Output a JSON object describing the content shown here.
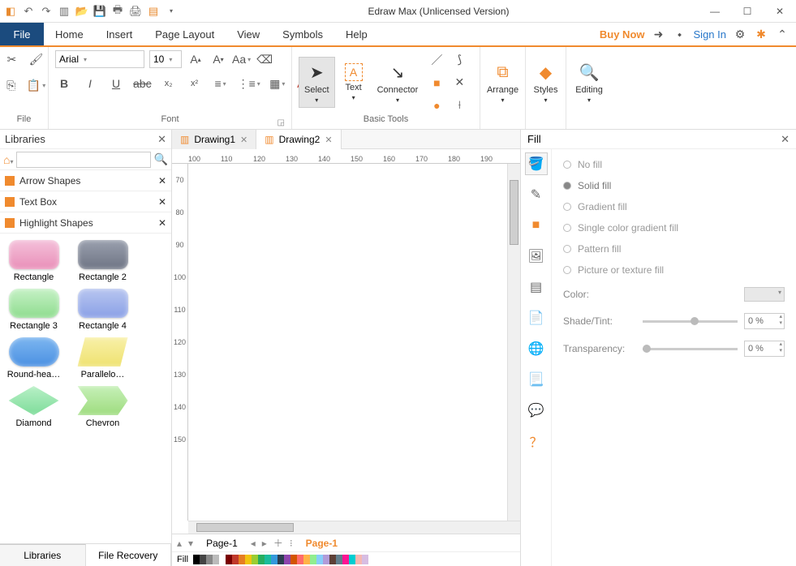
{
  "app": {
    "title": "Edraw Max (Unlicensed Version)"
  },
  "menu": {
    "file": "File",
    "tabs": [
      "Home",
      "Insert",
      "Page Layout",
      "View",
      "Symbols",
      "Help"
    ],
    "active_tab": "Home",
    "buy": "Buy Now",
    "signin": "Sign In"
  },
  "ribbon": {
    "group_file": "File",
    "group_font": "Font",
    "group_tools": "Basic Tools",
    "font_name": "Arial",
    "font_size": "10",
    "select": "Select",
    "text": "Text",
    "connector": "Connector",
    "arrange": "Arrange",
    "styles": "Styles",
    "editing": "Editing"
  },
  "libraries": {
    "title": "Libraries",
    "search_placeholder": "",
    "cats": [
      "Arrow Shapes",
      "Text Box",
      "Highlight Shapes"
    ],
    "shapes": [
      {
        "name": "Rectangle",
        "bg": "linear-gradient(#f4c1da,#e98fb8)",
        "radius": "10px"
      },
      {
        "name": "Rectangle 2",
        "bg": "linear-gradient(#9aa0ae,#6e7484)",
        "radius": "10px"
      },
      {
        "name": "Rectangle 3",
        "bg": "linear-gradient(#c6f1c6,#8edc8e)",
        "radius": "12px"
      },
      {
        "name": "Rectangle 4",
        "bg": "linear-gradient(#b8c6f0,#8aa0e6)",
        "radius": "10px"
      },
      {
        "name": "Round-hea…",
        "bg": "linear-gradient(#7db6f0,#4a90e2)",
        "radius": "18px"
      },
      {
        "name": "Parallelo…",
        "bg": "linear-gradient(#f8f0a8,#efe270)",
        "clip": "polygon(15% 0,100% 0,85% 100%,0 100%)"
      },
      {
        "name": "Diamond",
        "bg": "linear-gradient(#b8f0c6,#7edc9a)",
        "clip": "polygon(50% 0,100% 50%,50% 100%,0 50%)"
      },
      {
        "name": "Chevron",
        "bg": "linear-gradient(#c6f0b8,#9edc7e)",
        "clip": "polygon(0 0,80% 0,100% 50%,80% 100%,0 100%,20% 50%)"
      }
    ],
    "bottom_tabs": [
      "Libraries",
      "File Recovery"
    ]
  },
  "docs": {
    "tabs": [
      "Drawing1",
      "Drawing2"
    ],
    "active": 1
  },
  "ruler_h": [
    "100",
    "110",
    "120",
    "130",
    "140",
    "150",
    "160",
    "170",
    "180",
    "190"
  ],
  "ruler_v": [
    "70",
    "80",
    "90",
    "100",
    "110",
    "120",
    "130",
    "140",
    "150"
  ],
  "page_tabs": {
    "current": "Page-1",
    "selected": "Page-1"
  },
  "fill_row_label": "Fill",
  "fill": {
    "title": "Fill",
    "options": [
      "No fill",
      "Solid fill",
      "Gradient fill",
      "Single color gradient fill",
      "Pattern fill",
      "Picture or texture fill"
    ],
    "selected": 1,
    "color_label": "Color:",
    "shade_label": "Shade/Tint:",
    "shade_value": "0 %",
    "trans_label": "Transparency:",
    "trans_value": "0 %"
  },
  "swatches": [
    "#000",
    "#444",
    "#888",
    "#bbb",
    "#fff",
    "#7a0000",
    "#c0392b",
    "#e67e22",
    "#f1c40f",
    "#9acd32",
    "#27ae60",
    "#1abc9c",
    "#3498db",
    "#2c3e50",
    "#8e44ad",
    "#d35400",
    "#ff6b6b",
    "#ffb347",
    "#90ee90",
    "#87cefa",
    "#b19cd9",
    "#5d4037",
    "#607d8b",
    "#ff1493",
    "#00ced1",
    "#f5b7b1",
    "#d7bde2"
  ]
}
